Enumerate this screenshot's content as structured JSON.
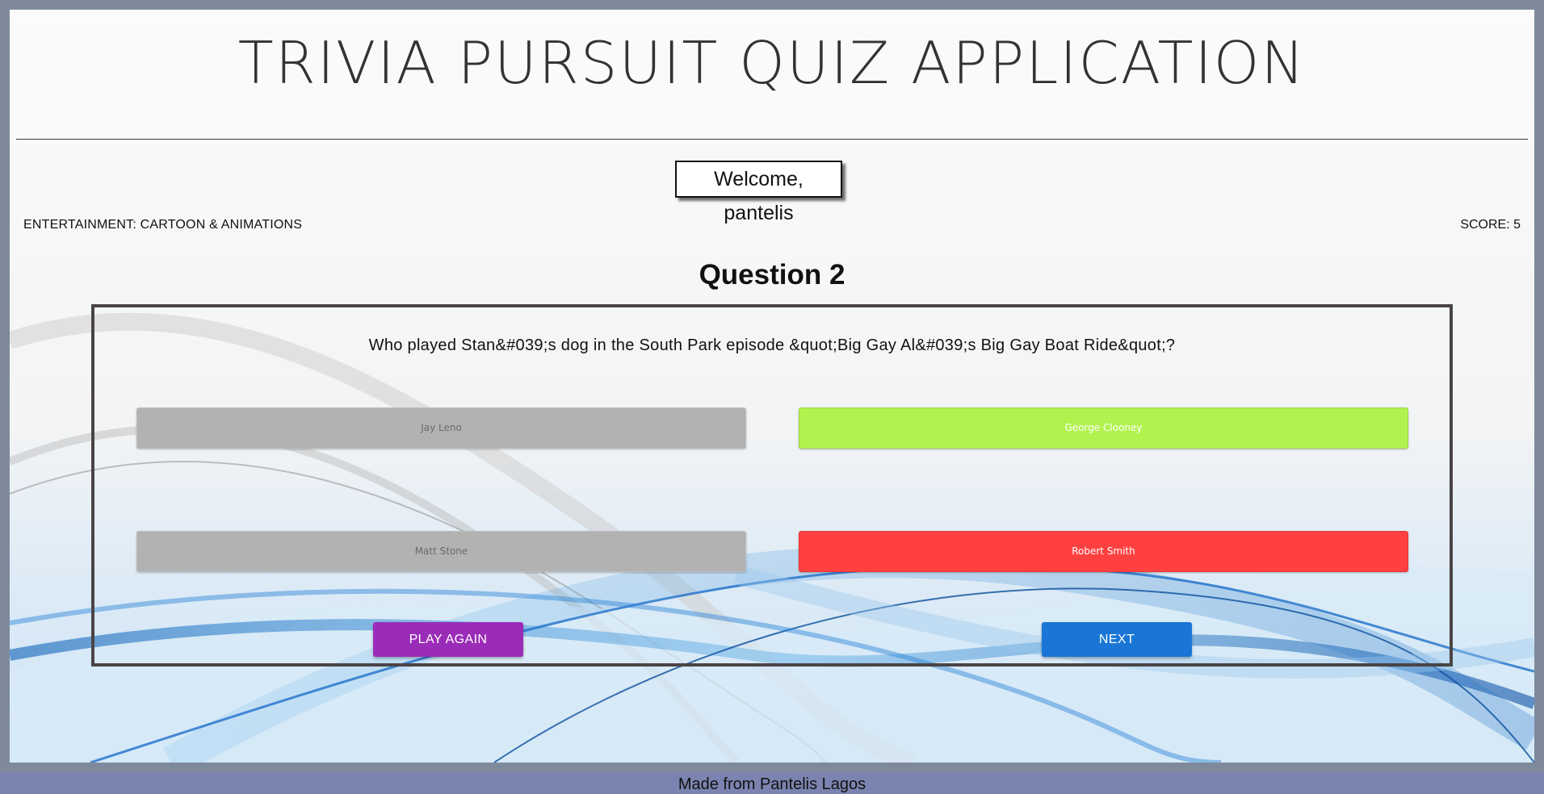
{
  "header": {
    "title": "TRIVIA PURSUIT QUIZ APPLICATION"
  },
  "welcome": {
    "text": "Welcome, pantelis"
  },
  "status": {
    "category": "ENTERTAINMENT: CARTOON & ANIMATIONS",
    "score": "SCORE: 5"
  },
  "question": {
    "heading": "Question 2",
    "text": "Who played Stan&#039;s dog in the South Park episode &quot;Big Gay Al&#039;s Big Gay Boat Ride&quot;?",
    "answers": [
      {
        "label": "Jay Leno",
        "state": "neutral"
      },
      {
        "label": "George Clooney",
        "state": "correct"
      },
      {
        "label": "Matt Stone",
        "state": "neutral"
      },
      {
        "label": "Robert Smith",
        "state": "wrong"
      }
    ]
  },
  "actions": {
    "play_again_label": "PLAY AGAIN",
    "next_label": "NEXT"
  },
  "footer": {
    "text": "Made from Pantelis Lagos"
  },
  "colors": {
    "frame": "#7e8a9c",
    "correct": "#b2f24f",
    "wrong": "#ff4040",
    "neutral": "#b2b2b2",
    "play_again": "#9b2cb8",
    "next": "#1976d6",
    "footer": "#7b83b0"
  }
}
